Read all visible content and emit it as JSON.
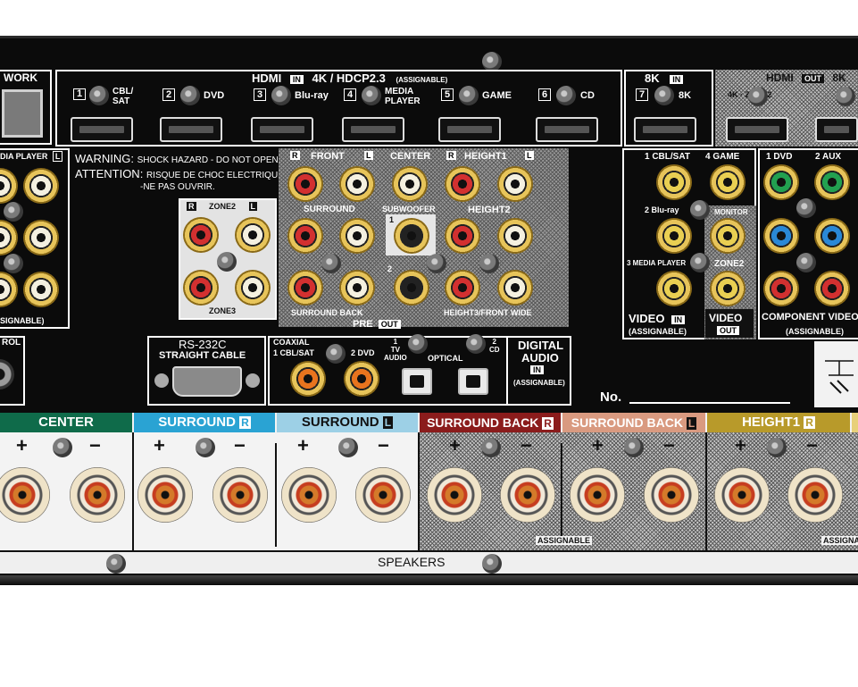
{
  "hdmi": {
    "header": "HDMI",
    "in_badge": "IN",
    "spec": "4K / HDCP2.3",
    "assignable": "(ASSIGNABLE)",
    "ports": [
      {
        "num": "1",
        "label": "CBL/\nSAT"
      },
      {
        "num": "2",
        "label": "DVD"
      },
      {
        "num": "3",
        "label": "Blu-ray"
      },
      {
        "num": "4",
        "label": "MEDIA\nPLAYER"
      },
      {
        "num": "5",
        "label": "GAME"
      },
      {
        "num": "6",
        "label": "CD"
      }
    ],
    "eightk_header": "8K",
    "eightk_in": "IN",
    "eightk_port": {
      "num": "7",
      "label": "8K"
    },
    "out_header": "HDMI",
    "out_badge": "OUT",
    "out_8k": "8K",
    "out_4k_zone2": "4K · ZONE2"
  },
  "network": "WORK",
  "warning": {
    "line1_a": "WARNING:",
    "line1_b": "SHOCK HAZARD - DO NOT OPEN.",
    "line2_a": "ATTENTION:",
    "line2_b": "RISQUE DE CHOC ELECTRIQUE",
    "line3": "-NE PAS OUVRIR."
  },
  "left_panel": {
    "top": "DIA PLAYER",
    "top_badge": "L",
    "bottom": "SIGNABLE)"
  },
  "zone": {
    "r": "R",
    "zone2": "ZONE2",
    "l": "L",
    "zone3": "ZONE3"
  },
  "preout": {
    "front": "FRONT",
    "center": "CENTER",
    "height1": "HEIGHT1",
    "surround": "SURROUND",
    "subwoofer": "SUBWOOFER",
    "height2": "HEIGHT2",
    "sub1": "1",
    "sub2": "2",
    "surround_back": "SURROUND BACK",
    "height3": "HEIGHT3/FRONT WIDE",
    "pre": "PRE",
    "out": "OUT",
    "r": "R",
    "l": "L"
  },
  "video_in": {
    "p1": "1 CBL/SAT",
    "p4": "4 GAME",
    "p2": "2 Blu-ray",
    "monitor": "MONITOR",
    "p3": "3 MEDIA PLAYER",
    "zone2": "ZONE2",
    "video": "VIDEO",
    "in": "IN",
    "assignable": "(ASSIGNABLE)",
    "video2": "VIDEO",
    "out": "OUT"
  },
  "component": {
    "p1": "1 DVD",
    "p2": "2 AUX",
    "label": "COMPONENT VIDEO",
    "in": "IN",
    "assignable": "(ASSIGNABLE)"
  },
  "control": "ROL",
  "rs232": {
    "title": "RS-232C",
    "sub": "STRAIGHT CABLE"
  },
  "digital": {
    "coaxial": "COAXIAL",
    "c1": "1 CBL/SAT",
    "c2": "2 DVD",
    "o1": "1\nTV\nAUDIO",
    "optical": "OPTICAL",
    "o2": "2\nCD",
    "title1": "DIGITAL",
    "title2": "AUDIO",
    "in": "IN",
    "assignable": "(ASSIGNABLE)"
  },
  "serial_no": "No.",
  "speakers": {
    "bands": [
      {
        "label": "CENTER",
        "badge": "",
        "color": "#0f6b4a"
      },
      {
        "label": "SURROUND",
        "badge": "R",
        "color": "#2aa3d3"
      },
      {
        "label": "SURROUND",
        "badge": "L",
        "color": "#9dd0e6"
      },
      {
        "label": "SURROUND BACK",
        "badge": "R",
        "color": "#8b1c1c"
      },
      {
        "label": "SURROUND BACK",
        "badge": "L",
        "color": "#d99a80"
      },
      {
        "label": "HEIGHT1",
        "badge": "R",
        "color": "#b89a2a"
      }
    ],
    "assignable": "ASSIGNABLE",
    "assignable2": "ASSIGNA",
    "footer": "SPEAKERS",
    "plus": "+",
    "minus": "−"
  }
}
